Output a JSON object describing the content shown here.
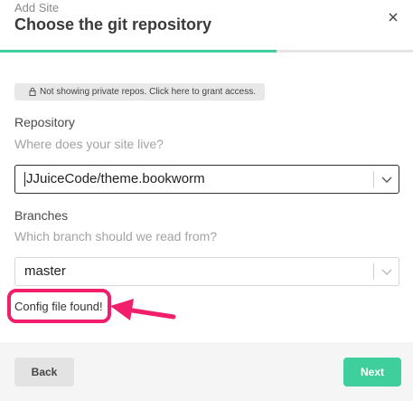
{
  "header": {
    "eyebrow": "Add Site",
    "title": "Choose the git repository"
  },
  "progress": {
    "fraction": 0.67,
    "color": "#3ecf9c"
  },
  "notice": {
    "text": "Not showing private repos. Click here to grant access."
  },
  "repository": {
    "label": "Repository",
    "hint": "Where does your site live?",
    "value": "JJuiceCode/theme.bookworm"
  },
  "branches": {
    "label": "Branches",
    "hint": "Which branch should we read from?",
    "value": "master"
  },
  "status": {
    "text": "Config file found!"
  },
  "annotation": {
    "color": "#f01e6b"
  },
  "footer": {
    "back_label": "Back",
    "next_label": "Next"
  },
  "colors": {
    "accent": "#3ecf9c",
    "highlight": "#f01e6b"
  }
}
